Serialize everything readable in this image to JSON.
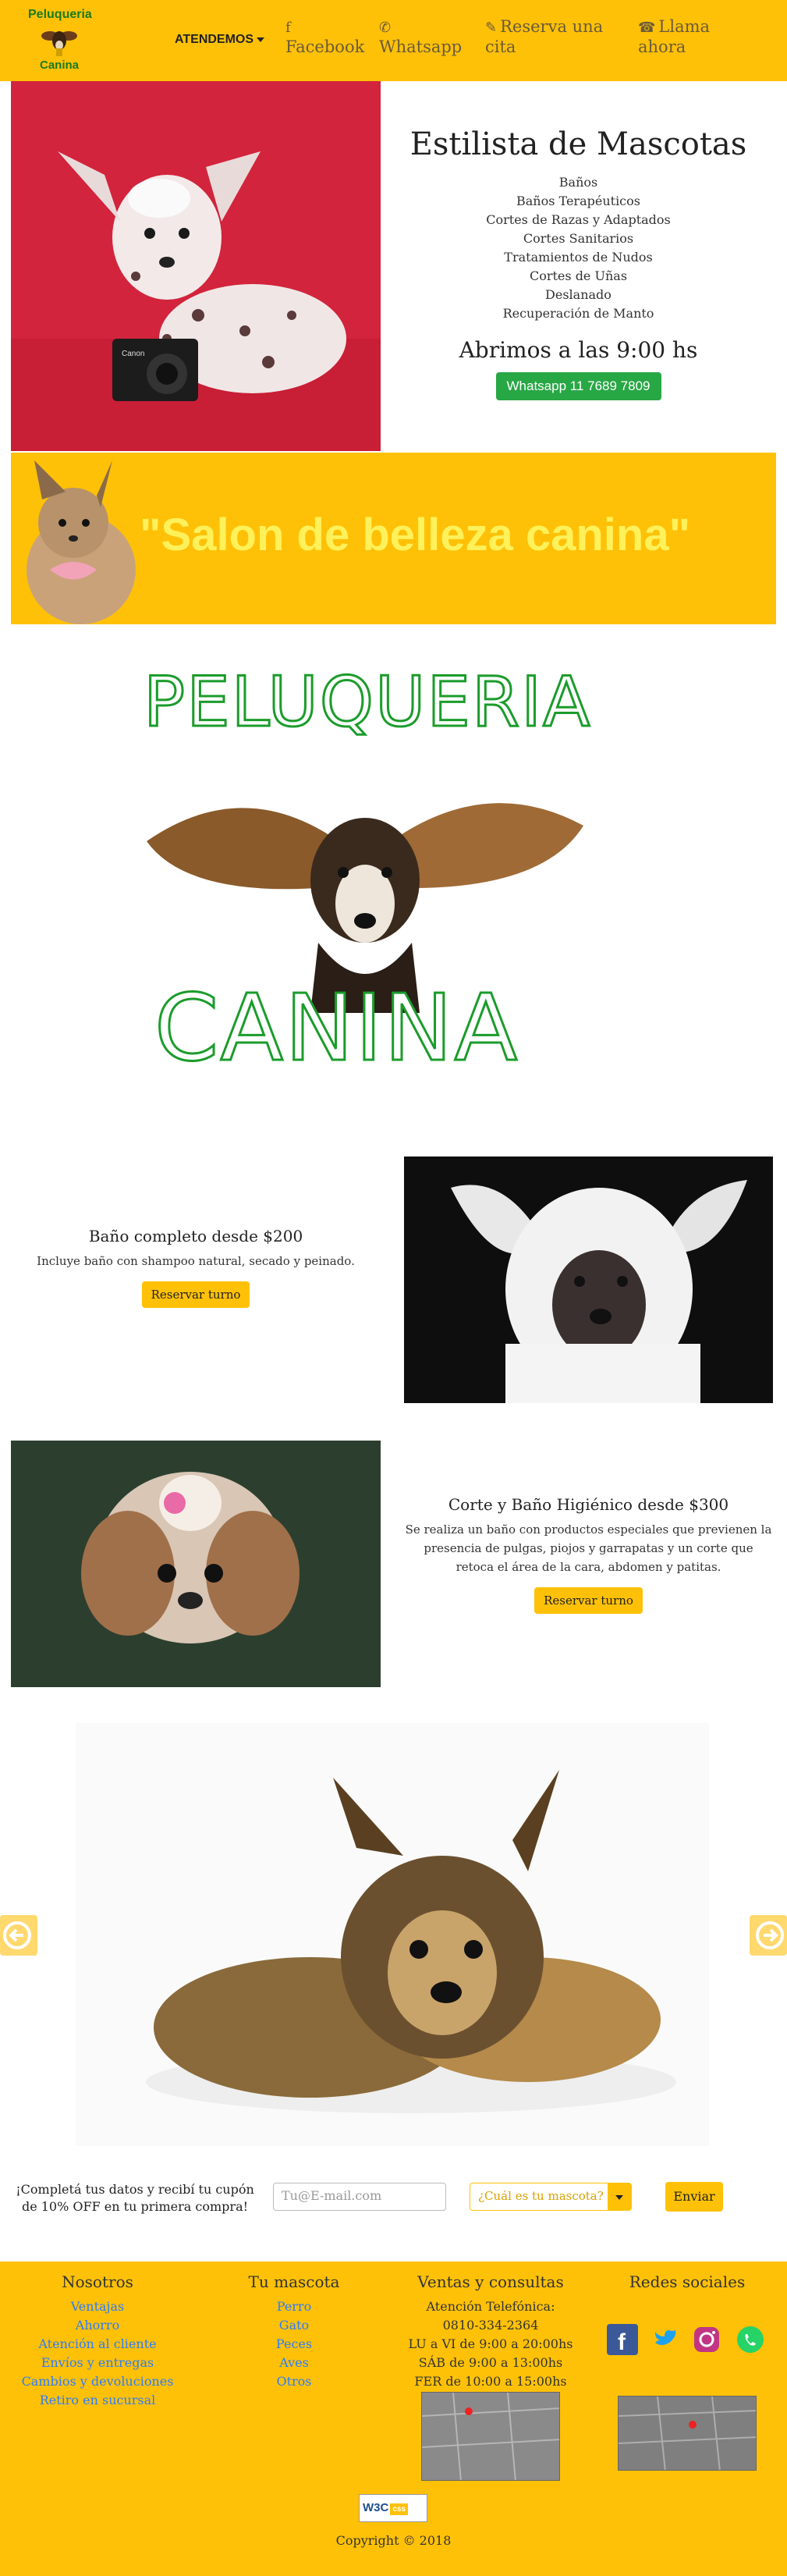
{
  "header": {
    "logo_line1": "Peluqueria",
    "logo_line2": "Canina",
    "menu_label": "ATENDEMOS",
    "links": [
      {
        "label": "Facebook",
        "icon": "facebook-icon"
      },
      {
        "label": "Whatsapp",
        "icon": "whatsapp-icon"
      },
      {
        "label": "Reserva una cita",
        "icon": "pencil-icon"
      },
      {
        "label": "Llama ahora",
        "icon": "phone-icon"
      }
    ]
  },
  "hero": {
    "title": "Estilista de Mascotas",
    "services": [
      "Baños",
      "Baños Terapéuticos",
      "Cortes de Razas y Adaptados",
      "Cortes Sanitarios",
      "Tratamientos de Nudos",
      "Cortes de Uñas",
      "Deslanado",
      "Recuperación de Manto"
    ],
    "hours": "Abrimos a las 9:00 hs",
    "whatsapp_button": "Whatsapp 11 7689 7809",
    "camera_brand": "Canon"
  },
  "banner": {
    "text": "\"Salon de belleza canina\""
  },
  "big_logo": {
    "line1": "PELUQUERIA",
    "line2": "CANINA"
  },
  "services": [
    {
      "title": "Baño completo desde $200",
      "description": "Incluye baño con shampoo natural, secado y peinado.",
      "button": "Reservar turno"
    },
    {
      "title": "Corte y Baño Higiénico desde $300",
      "description": "Se realiza un baño con productos especiales que previenen la presencia de pulgas, piojos y garrapatas y un corte que retoca el área de la cara, abdomen y patitas.",
      "button": "Reservar turno"
    }
  ],
  "newsletter": {
    "text": "¡Completá tus datos y recibí tu cupón de 10% OFF en tu primera compra!",
    "email_placeholder": "Tu@E-mail.com",
    "pet_select": "¿Cuál es tu mascota?",
    "submit": "Enviar"
  },
  "footer": {
    "nosotros": {
      "title": "Nosotros",
      "items": [
        "Ventajas",
        "Ahorro",
        "Atención al cliente",
        "Envíos y entregas",
        "Cambios y devoluciones",
        "Retiro en sucursal"
      ]
    },
    "mascota": {
      "title": "Tu mascota",
      "items": [
        "Perro",
        "Gato",
        "Peces",
        "Aves",
        "Otros"
      ]
    },
    "ventas": {
      "title": "Ventas y consultas",
      "lines": [
        "Atención Telefónica:",
        "0810-334-2364",
        "LU a VI de 9:00 a 20:00hs",
        "SÁB de 9:00 a 13:00hs",
        "FER de 10:00 a 15:00hs"
      ]
    },
    "redes": {
      "title": "Redes sociales"
    },
    "w3c_label": "W3C",
    "css_label": "css",
    "copyright": "Copyright © 2018"
  },
  "colors": {
    "accent": "#ffc107",
    "whatsapp": "#28a745",
    "link": "#2a7cff",
    "hero_bg": "#d2243c"
  }
}
